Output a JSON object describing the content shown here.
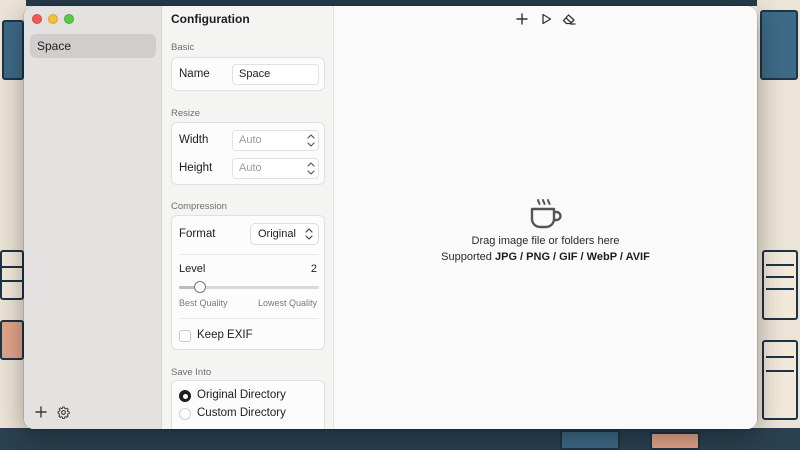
{
  "sidebar": {
    "items": [
      {
        "label": "Space",
        "selected": true
      }
    ],
    "icons": {
      "add": "plus-icon",
      "settings": "gear-icon"
    }
  },
  "config": {
    "title": "Configuration",
    "basic": {
      "label": "Basic",
      "name_label": "Name",
      "name_value": "Space"
    },
    "resize": {
      "label": "Resize",
      "width_label": "Width",
      "width_placeholder": "Auto",
      "height_label": "Height",
      "height_placeholder": "Auto"
    },
    "compression": {
      "label": "Compression",
      "format_label": "Format",
      "format_value": "Original",
      "level_label": "Level",
      "level_value": "2",
      "slider_fraction": 0.15,
      "min_caption": "Best Quality",
      "max_caption": "Lowest Quality",
      "keep_exif_label": "Keep EXIF",
      "keep_exif_checked": false
    },
    "save_into": {
      "label": "Save Into",
      "options": [
        {
          "label": "Original Directory",
          "selected": true
        },
        {
          "label": "Custom Directory",
          "selected": false
        }
      ]
    }
  },
  "toolbar": {
    "icons": [
      "plus-icon",
      "play-icon",
      "eraser-icon"
    ]
  },
  "drop_zone": {
    "icon": "coffee-cup-icon",
    "line1": "Drag image file or folders here",
    "line2_prefix": "Supported ",
    "line2_formats": "JPG / PNG / GIF / WebP / AVIF"
  },
  "colors": {
    "sidebar_bg": "#e3e2e0",
    "selected_item": "#cfcecc",
    "close": "#ee5c55",
    "minimize": "#f5be3e",
    "zoom": "#5bc84a"
  }
}
